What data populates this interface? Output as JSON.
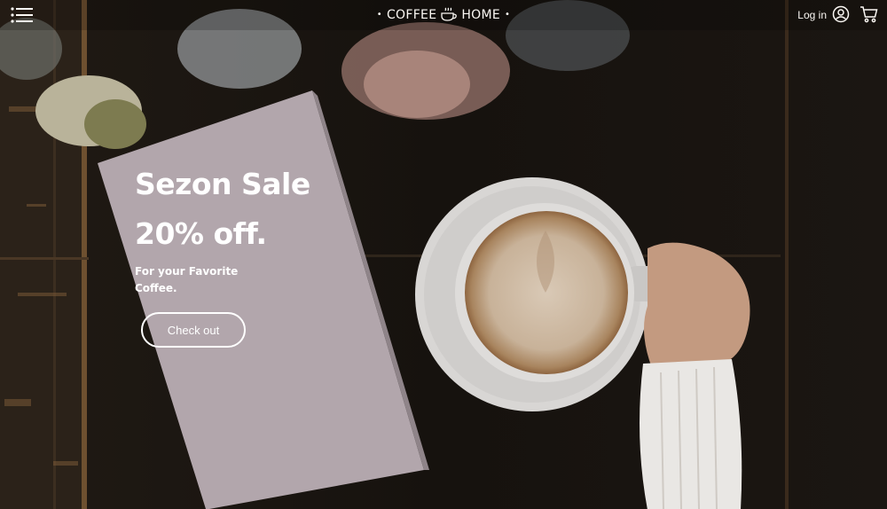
{
  "header": {
    "brand_left": "COFFEE",
    "brand_right": "HOME",
    "login_label": "Log in"
  },
  "hero": {
    "title": "Sezon Sale",
    "discount": "20% off.",
    "subtitle_line1": "For your Favorite",
    "subtitle_line2": "Coffee.",
    "cta_label": "Check out"
  },
  "icons": {
    "menu": "hamburger-menu-icon",
    "brand_logo": "coffee-cup-logo-icon",
    "account": "user-circle-icon",
    "cart": "shopping-cart-icon"
  },
  "colors": {
    "card": "#b2a6ac",
    "text": "#ffffff",
    "background": "#1c1814"
  }
}
